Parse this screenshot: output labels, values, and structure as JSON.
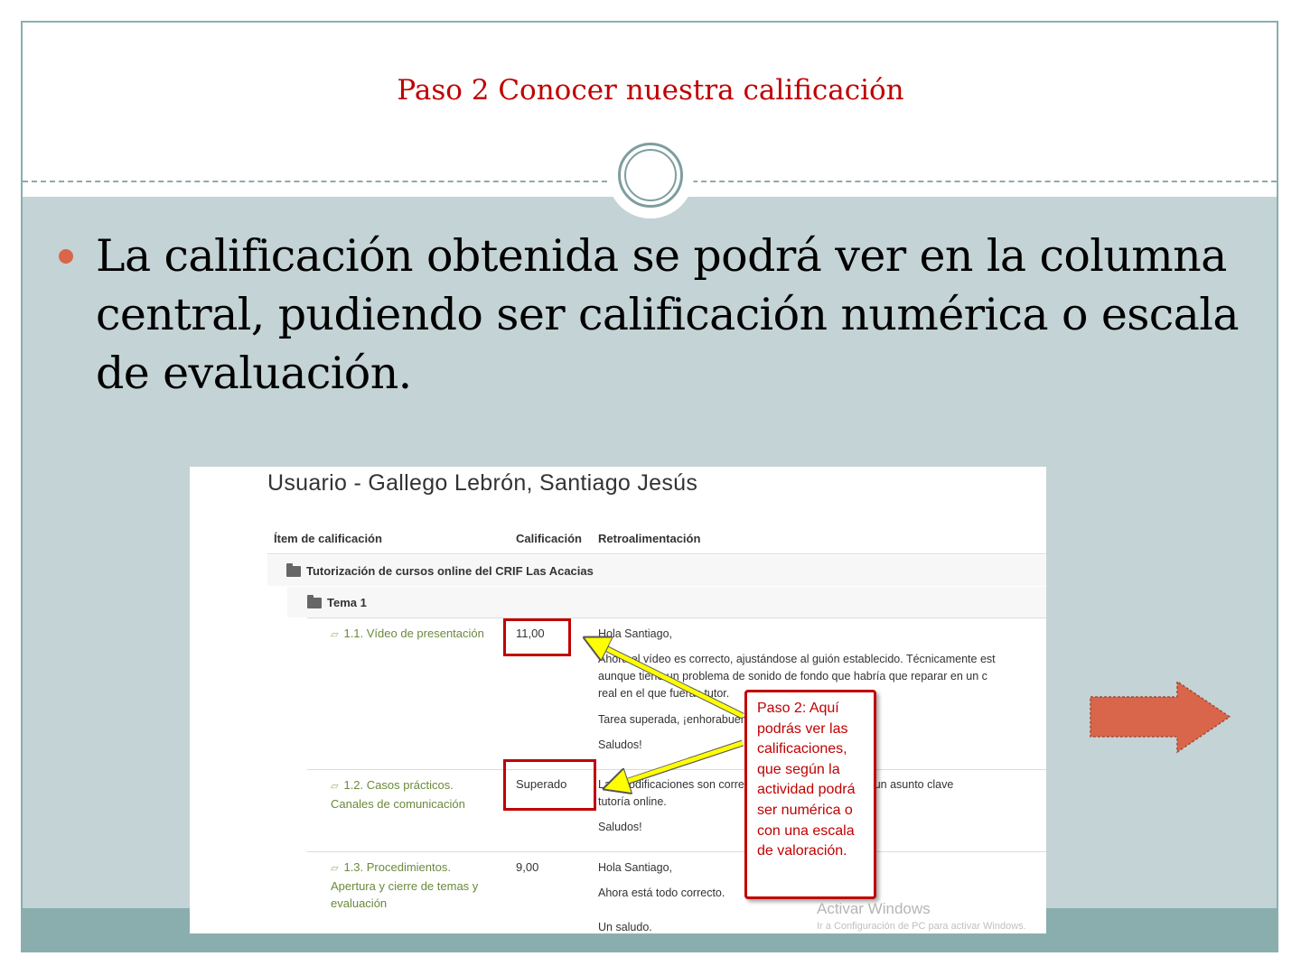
{
  "slide": {
    "title": "Paso 2 Conocer nuestra calificación",
    "bullet": "La calificación obtenida se podrá ver en la columna central, pudiendo ser calificación numérica o escala de evaluación."
  },
  "screenshot": {
    "user_title": "Usuario - Gallego Lebrón, Santiago Jesús",
    "columns": [
      "Ítem de calificación",
      "Calificación",
      "Retroalimentación"
    ],
    "course": "Tutorización de cursos online del CRIF Las Acacias",
    "topic": "Tema 1",
    "items": [
      {
        "name": "1.1. Vídeo de presentación",
        "grade": "11,00",
        "feedback": [
          "Hola Santiago,",
          "Ahora el vídeo es correcto, ajustándose al guión establecido. Técnicamente est",
          "aunque tiene un problema de sonido de fondo que habría que reparar en un c",
          "real en el que fueras tutor.",
          "Tarea superada, ¡enhorabuena!",
          "Saludos!"
        ]
      },
      {
        "name_lines": [
          "1.2. Casos prácticos.",
          "Canales de comunicación"
        ],
        "grade": "Superado",
        "feedback": [
          "Las modificaciones son correctas. La comunicación es un asunto clave",
          "tutoría online.",
          "Saludos!"
        ]
      },
      {
        "name_lines": [
          "1.3. Procedimientos.",
          "Apertura y cierre de temas y",
          "evaluación"
        ],
        "grade": "9,00",
        "feedback": [
          "Hola Santiago,",
          "Ahora está todo correcto.",
          "Un saludo."
        ]
      }
    ],
    "callout": "Paso 2: Aquí podrás ver las calificaciones, que según la actividad podrá ser numérica o con una escala de valoración.",
    "watermark_title": "Activar Windows",
    "watermark_sub": "Ir a Configuración de PC para activar Windows."
  },
  "colors": {
    "title_red": "#c00000",
    "content_bg": "#c4d3d5",
    "band_teal": "#8aaeae",
    "bullet": "#d9664a",
    "arrow_orange": "#d9664a",
    "link_green": "#6a8a3a",
    "annotation_yellow": "#ffff00"
  },
  "icons": {
    "folder": "folder-icon",
    "assignment": "assignment-icon",
    "next": "right-arrow-icon"
  }
}
